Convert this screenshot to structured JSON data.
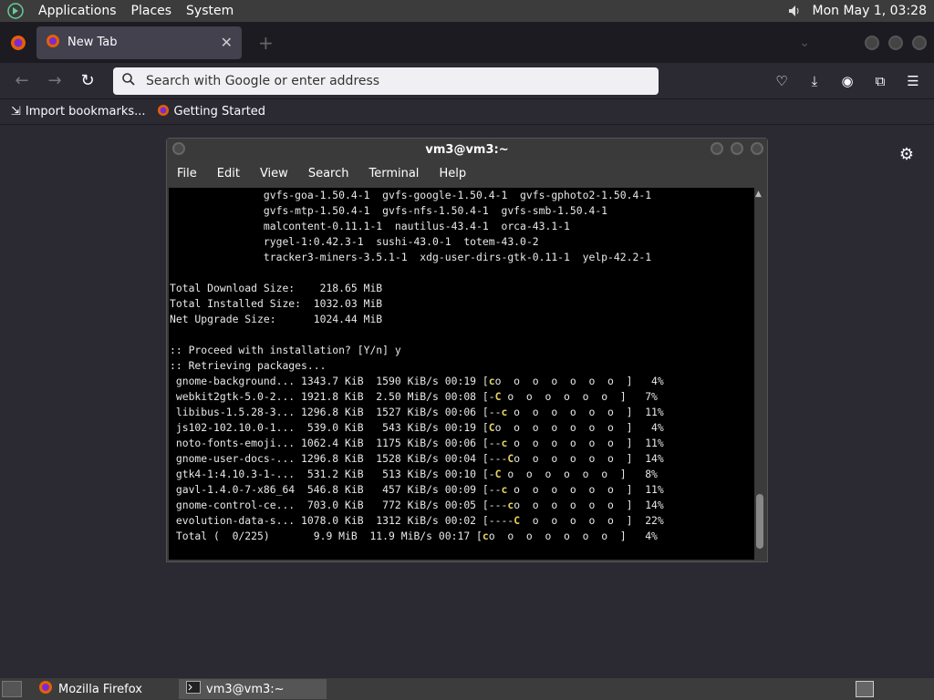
{
  "top_panel": {
    "menus": [
      "Applications",
      "Places",
      "System"
    ],
    "clock": "Mon May  1, 03:28"
  },
  "firefox": {
    "tab_title": "New Tab",
    "url_placeholder": "Search with Google or enter address",
    "bookmarks": [
      "Import bookmarks...",
      "Getting Started"
    ]
  },
  "terminal": {
    "title": "vm3@vm3:~",
    "menus": [
      "File",
      "Edit",
      "View",
      "Search",
      "Terminal",
      "Help"
    ],
    "lines": [
      "               gvfs-goa-1.50.4-1  gvfs-google-1.50.4-1  gvfs-gphoto2-1.50.4-1",
      "               gvfs-mtp-1.50.4-1  gvfs-nfs-1.50.4-1  gvfs-smb-1.50.4-1",
      "               malcontent-0.11.1-1  nautilus-43.4-1  orca-43.1-1",
      "               rygel-1:0.42.3-1  sushi-43.0-1  totem-43.0-2",
      "               tracker3-miners-3.5.1-1  xdg-user-dirs-gtk-0.11-1  yelp-42.2-1",
      "",
      "Total Download Size:    218.65 MiB",
      "Total Installed Size:  1032.03 MiB",
      "Net Upgrade Size:      1024.44 MiB",
      "",
      ":: Proceed with installation? [Y/n] y",
      ":: Retrieving packages..."
    ],
    "downloads": [
      {
        "name": " gnome-background...",
        "size": "1343.7 KiB",
        "rate": "1590 KiB/s",
        "eta": "00:19",
        "pre": "[",
        "pac": "c",
        "post": "o  o  o  o  o  o  o  ]",
        "pct": "  4%"
      },
      {
        "name": " webkit2gtk-5.0-2...",
        "size": "1921.8 KiB",
        "rate": "2.50 MiB/s",
        "eta": "00:08",
        "pre": "[-",
        "pac": "C",
        "post": " o  o  o  o  o  o  ]",
        "pct": "  7%"
      },
      {
        "name": " libibus-1.5.28-3...",
        "size": "1296.8 KiB",
        "rate": "1527 KiB/s",
        "eta": "00:06",
        "pre": "[--",
        "pac": "c",
        "post": " o  o  o  o  o  o  ]",
        "pct": " 11%"
      },
      {
        "name": " js102-102.10.0-1...",
        "size": " 539.0 KiB",
        "rate": " 543 KiB/s",
        "eta": "00:19",
        "pre": "[",
        "pac": "C",
        "post": "o  o  o  o  o  o  o  ]",
        "pct": "  4%"
      },
      {
        "name": " noto-fonts-emoji...",
        "size": "1062.4 KiB",
        "rate": "1175 KiB/s",
        "eta": "00:06",
        "pre": "[--",
        "pac": "c",
        "post": " o  o  o  o  o  o  ]",
        "pct": " 11%"
      },
      {
        "name": " gnome-user-docs-...",
        "size": "1296.8 KiB",
        "rate": "1528 KiB/s",
        "eta": "00:04",
        "pre": "[---",
        "pac": "C",
        "post": "o  o  o  o  o  o  ]",
        "pct": " 14%"
      },
      {
        "name": " gtk4-1:4.10.3-1-...",
        "size": " 531.2 KiB",
        "rate": " 513 KiB/s",
        "eta": "00:10",
        "pre": "[-",
        "pac": "C",
        "post": " o  o  o  o  o  o  ]",
        "pct": "  8%"
      },
      {
        "name": " gavl-1.4.0-7-x86_64",
        "size": " 546.8 KiB",
        "rate": " 457 KiB/s",
        "eta": "00:09",
        "pre": "[--",
        "pac": "c",
        "post": " o  o  o  o  o  o  ]",
        "pct": " 11%"
      },
      {
        "name": " gnome-control-ce...",
        "size": " 703.0 KiB",
        "rate": " 772 KiB/s",
        "eta": "00:05",
        "pre": "[---",
        "pac": "c",
        "post": "o  o  o  o  o  o  ]",
        "pct": " 14%"
      },
      {
        "name": " evolution-data-s...",
        "size": "1078.0 KiB",
        "rate": "1312 KiB/s",
        "eta": "00:02",
        "pre": "[----",
        "pac": "C",
        "post": "  o  o  o  o  o  ]",
        "pct": " 22%"
      },
      {
        "name": " Total (  0/225)   ",
        "size": "   9.9 MiB",
        "rate": "11.9 MiB/s",
        "eta": "00:17",
        "pre": "[",
        "pac": "c",
        "post": "o  o  o  o  o  o  o  ]",
        "pct": "  4%"
      }
    ]
  },
  "taskbar": {
    "tasks": [
      "Mozilla Firefox",
      "vm3@vm3:~"
    ]
  },
  "colors": {
    "pacman": "#e5d35e",
    "panel": "#3c3c3c",
    "firefox_bg": "#2b2a33"
  }
}
